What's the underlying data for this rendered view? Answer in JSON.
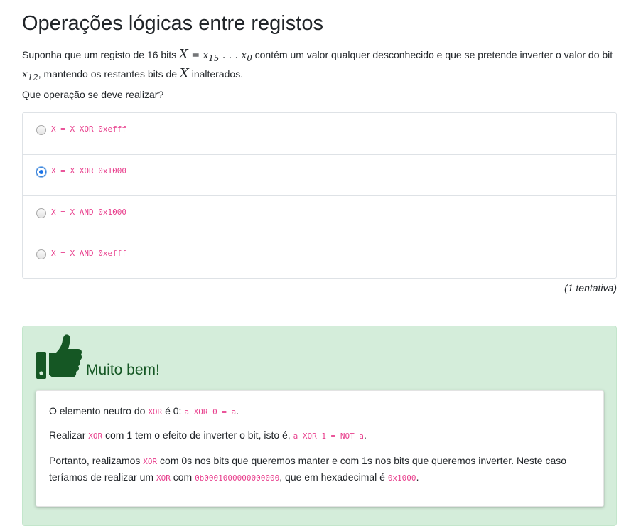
{
  "title": "Operações lógicas entre registos",
  "question": {
    "part1": "Suponha que um registo de 16 bits ",
    "m_X": "X",
    "m_eq": " = ",
    "m_x": "x",
    "m_15": "15",
    "m_dots": " . . . ",
    "m_x2": "x",
    "m_0": "0",
    "part2": " contém um valor qualquer desconhecido e que se pretende inverter o valor do bit ",
    "m_x3": "x",
    "m_12": "12",
    "part3": ", mantendo os restantes bits de ",
    "m_X2": "X",
    "part4": " inalterados."
  },
  "prompt": "Que operação se deve realizar?",
  "options": [
    {
      "code": "X = X XOR 0xefff",
      "selected": false
    },
    {
      "code": "X = X XOR 0x1000",
      "selected": true
    },
    {
      "code": "X = X AND 0x1000",
      "selected": false
    },
    {
      "code": "X = X AND 0xefff",
      "selected": false
    }
  ],
  "attempts": "(1 tentativa)",
  "feedback": {
    "icon": "thumbs-up-icon",
    "title": "Muito bem!",
    "color": "#155724",
    "l1a": "O elemento neutro do ",
    "l1b": "XOR",
    "l1c": " é 0: ",
    "l1d": "a XOR 0 = a",
    "l1e": ".",
    "l2a": "Realizar ",
    "l2b": "XOR",
    "l2c": " com 1 tem o efeito de inverter o bit, isto é, ",
    "l2d": "a XOR 1 = NOT a",
    "l2e": ".",
    "l3a": "Portanto, realizamos ",
    "l3b": "XOR",
    "l3c": " com 0s nos bits que queremos manter e com 1s nos bits que queremos inverter. Neste caso teríamos de realizar um ",
    "l3d": "XOR",
    "l3e": " com ",
    "l3f": "0b0001000000000000",
    "l3g": ", que em hexadecimal é ",
    "l3h": "0x1000",
    "l3i": "."
  }
}
